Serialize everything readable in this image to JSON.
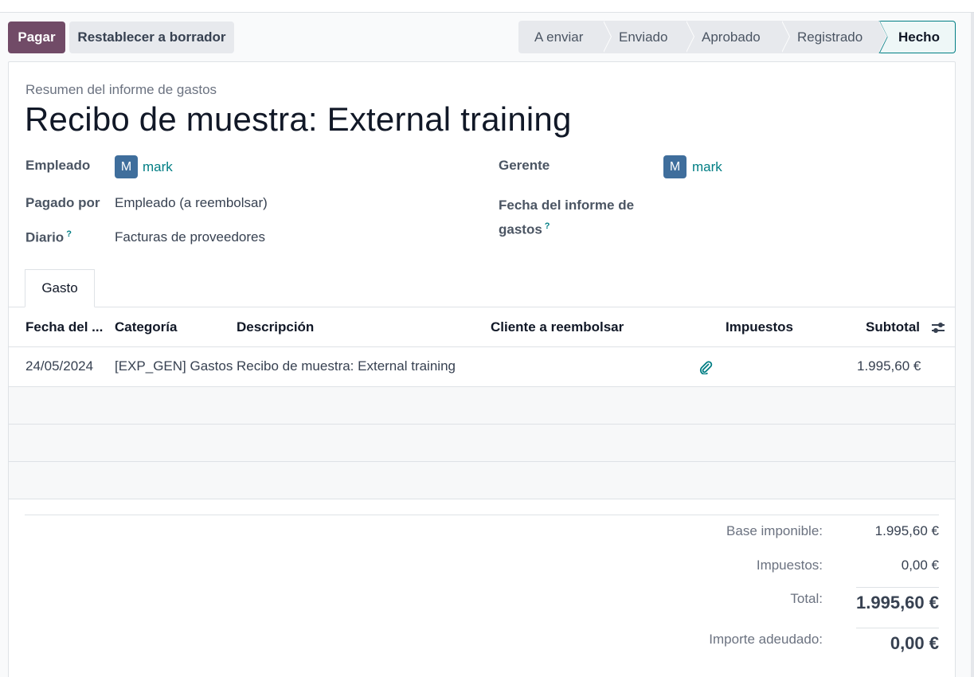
{
  "actions": {
    "pay_label": "Pagar",
    "reset_label": "Restablecer a borrador"
  },
  "stages": [
    {
      "label": "A enviar"
    },
    {
      "label": "Enviado"
    },
    {
      "label": "Aprobado"
    },
    {
      "label": "Registrado"
    },
    {
      "label": "Hecho"
    }
  ],
  "form": {
    "subtitle": "Resumen del informe de gastos",
    "title": "Recibo de muestra: External training",
    "employee_label": "Empleado",
    "employee_initial": "M",
    "employee_name": "mark",
    "paid_by_label": "Pagado por",
    "paid_by_value": "Empleado (a reembolsar)",
    "journal_label": "Diario",
    "journal_value": "Facturas de proveedores",
    "manager_label": "Gerente",
    "manager_initial": "M",
    "manager_name": "mark",
    "report_date_label_1": "Fecha del informe de",
    "report_date_label_2": "gastos",
    "help_mark": "?"
  },
  "tabs": [
    {
      "label": "Gasto"
    }
  ],
  "table": {
    "headers": {
      "date": "Fecha del ...",
      "category": "Categoría",
      "description": "Descripción",
      "customer": "Cliente a reembolsar",
      "taxes": "Impuestos",
      "subtotal": "Subtotal"
    },
    "rows": [
      {
        "date": "24/05/2024",
        "category": "[EXP_GEN] Gastos",
        "description": "Recibo de muestra: External training",
        "customer": "",
        "taxes": "",
        "subtotal": "1.995,60 €"
      }
    ]
  },
  "totals": {
    "base_label": "Base imponible:",
    "base_value": "1.995,60 €",
    "taxes_label": "Impuestos:",
    "taxes_value": "0,00 €",
    "total_label": "Total:",
    "total_value": "1.995,60 €",
    "due_label": "Importe adeudado:",
    "due_value": "0,00 €"
  },
  "colors": {
    "primary": "#714b67",
    "accent": "#017e84",
    "avatar": "#3f6e9c"
  },
  "icons": {
    "attachment": "paperclip-icon",
    "optional_columns": "sliders-icon"
  }
}
